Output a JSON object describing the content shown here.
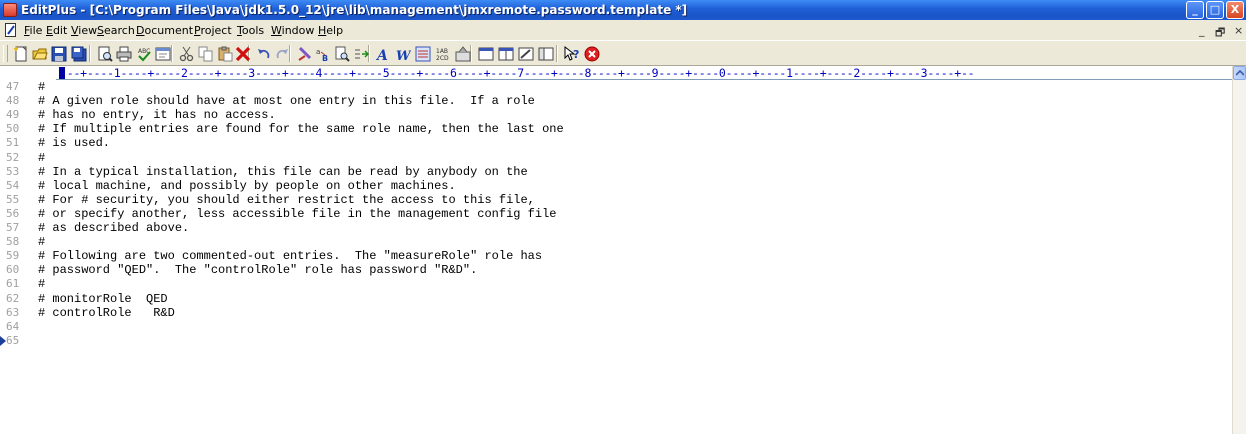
{
  "window": {
    "title": "EditPlus - [C:\\Program Files\\Java\\jdk1.5.0_12\\jre\\lib\\management\\jmxremote.password.template *]",
    "controls": {
      "minimize": "_",
      "maximize": "□",
      "close": "X"
    }
  },
  "menu": {
    "items": [
      {
        "pre": "",
        "u": "F",
        "post": "ile"
      },
      {
        "pre": "",
        "u": "E",
        "post": "dit"
      },
      {
        "pre": "",
        "u": "V",
        "post": "iew"
      },
      {
        "pre": "",
        "u": "S",
        "post": "earch"
      },
      {
        "pre": "",
        "u": "D",
        "post": "ocument"
      },
      {
        "pre": "",
        "u": "P",
        "post": "roject"
      },
      {
        "pre": "",
        "u": "T",
        "post": "ools"
      },
      {
        "pre": "",
        "u": "W",
        "post": "indow"
      },
      {
        "pre": "",
        "u": "H",
        "post": "elp"
      }
    ],
    "mdi": {
      "minimize": "_",
      "restore": "🗗",
      "close": "×"
    }
  },
  "toolbar": {
    "icons": [
      "new-file-icon",
      "open-folder-icon",
      "save-icon",
      "save-all-icon",
      "print-preview-icon",
      "print-icon",
      "spell-check-icon",
      "browser-icon",
      "cut-icon",
      "copy-icon",
      "paste-icon",
      "delete-icon",
      "undo-icon",
      "redo-icon",
      "find-icon",
      "replace-icon",
      "find-in-files-icon",
      "goto-icon",
      "font-icon",
      "word-wrap-icon",
      "line-numbers-icon",
      "ruler-icon",
      "preferences-icon",
      "single-window-icon",
      "split-window-icon",
      "tool-window-icon",
      "cliptext-icon",
      "help-icon",
      "stop-icon"
    ]
  },
  "ruler": {
    "text": "---+----1----+----2----+----3----+----4----+----5----+----6----+----7----+----8----+----9----+----0----+----1----+----2----+----3----+--"
  },
  "editor": {
    "lines": [
      {
        "num": "47",
        "text": "#"
      },
      {
        "num": "48",
        "text": "# A given role should have at most one entry in this file.  If a role"
      },
      {
        "num": "49",
        "text": "# has no entry, it has no access."
      },
      {
        "num": "50",
        "text": "# If multiple entries are found for the same role name, then the last one"
      },
      {
        "num": "51",
        "text": "# is used."
      },
      {
        "num": "52",
        "text": "#"
      },
      {
        "num": "53",
        "text": "# In a typical installation, this file can be read by anybody on the"
      },
      {
        "num": "54",
        "text": "# local machine, and possibly by people on other machines."
      },
      {
        "num": "55",
        "text": "# For # security, you should either restrict the access to this file,"
      },
      {
        "num": "56",
        "text": "# or specify another, less accessible file in the management config file"
      },
      {
        "num": "57",
        "text": "# as described above."
      },
      {
        "num": "58",
        "text": "#"
      },
      {
        "num": "59",
        "text": "# Following are two commented-out entries.  The \"measureRole\" role has"
      },
      {
        "num": "60",
        "text": "# password \"QED\".  The \"controlRole\" role has password \"R&D\"."
      },
      {
        "num": "61",
        "text": "#"
      },
      {
        "num": "62",
        "text": "# monitorRole  QED"
      },
      {
        "num": "63",
        "text": "# controlRole   R&D"
      },
      {
        "num": "64",
        "text": ""
      },
      {
        "num": "65",
        "text": ""
      }
    ]
  }
}
